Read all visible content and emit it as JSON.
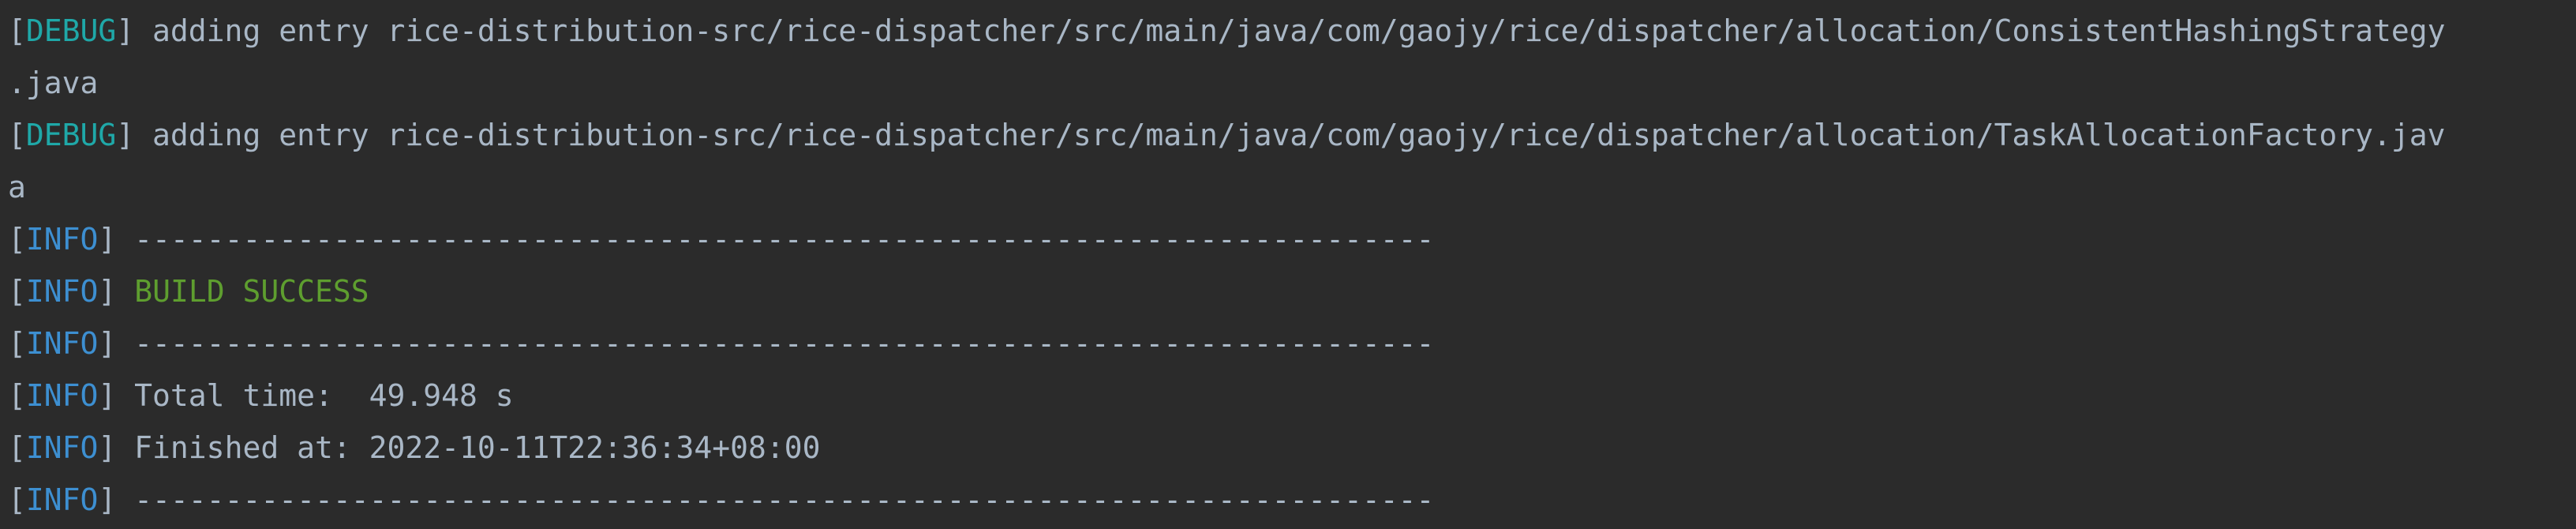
{
  "colors": {
    "background": "#2b2b2b",
    "text": "#a9b7c6",
    "debug": "#1fa8a8",
    "info": "#3d8fd1",
    "success": "#5e9e2f"
  },
  "lines": [
    {
      "tag": "DEBUG",
      "text": " adding entry rice-distribution-src/rice-dispatcher/src/main/java/com/gaojy/rice/dispatcher/allocation/ConsistentHashingStrategy"
    },
    {
      "text": ".java"
    },
    {
      "tag": "DEBUG",
      "text": " adding entry rice-distribution-src/rice-dispatcher/src/main/java/com/gaojy/rice/dispatcher/allocation/TaskAllocationFactory.jav"
    },
    {
      "text": "a"
    },
    {
      "tag": "INFO",
      "text": " ------------------------------------------------------------------------"
    },
    {
      "tag": "INFO",
      "prefix": " ",
      "success": "BUILD SUCCESS"
    },
    {
      "tag": "INFO",
      "text": " ------------------------------------------------------------------------"
    },
    {
      "tag": "INFO",
      "text": " Total time:  49.948 s"
    },
    {
      "tag": "INFO",
      "text": " Finished at: 2022-10-11T22:36:34+08:00"
    },
    {
      "tag": "INFO",
      "text": " ------------------------------------------------------------------------"
    }
  ]
}
